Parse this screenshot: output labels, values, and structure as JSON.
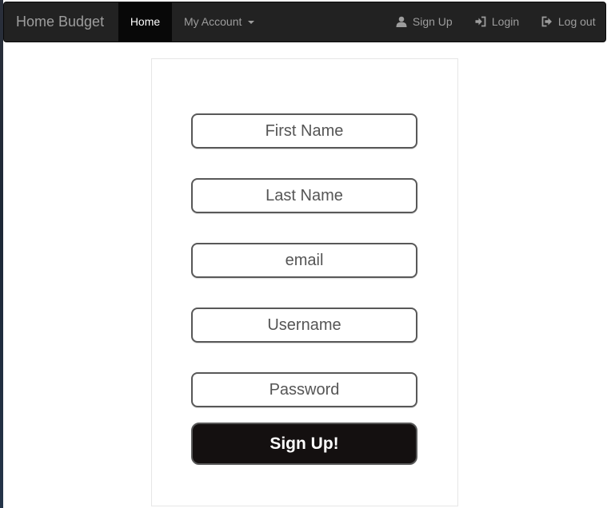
{
  "navbar": {
    "brand": "Home Budget",
    "home_label": "Home",
    "account_label": "My Account",
    "signup_label": "Sign Up",
    "login_label": "Login",
    "logout_label": "Log out"
  },
  "form": {
    "first_name_placeholder": "First Name",
    "last_name_placeholder": "Last Name",
    "email_placeholder": "email",
    "username_placeholder": "Username",
    "password_placeholder": "Password",
    "submit_label": "Sign Up!"
  },
  "colors": {
    "navbar_bg": "#222222",
    "active_tab_bg": "#080808",
    "submit_bg": "#141010"
  },
  "icons": {
    "signup": "user-icon",
    "login": "login-icon",
    "logout": "logout-icon",
    "dropdown": "caret-down-icon"
  }
}
